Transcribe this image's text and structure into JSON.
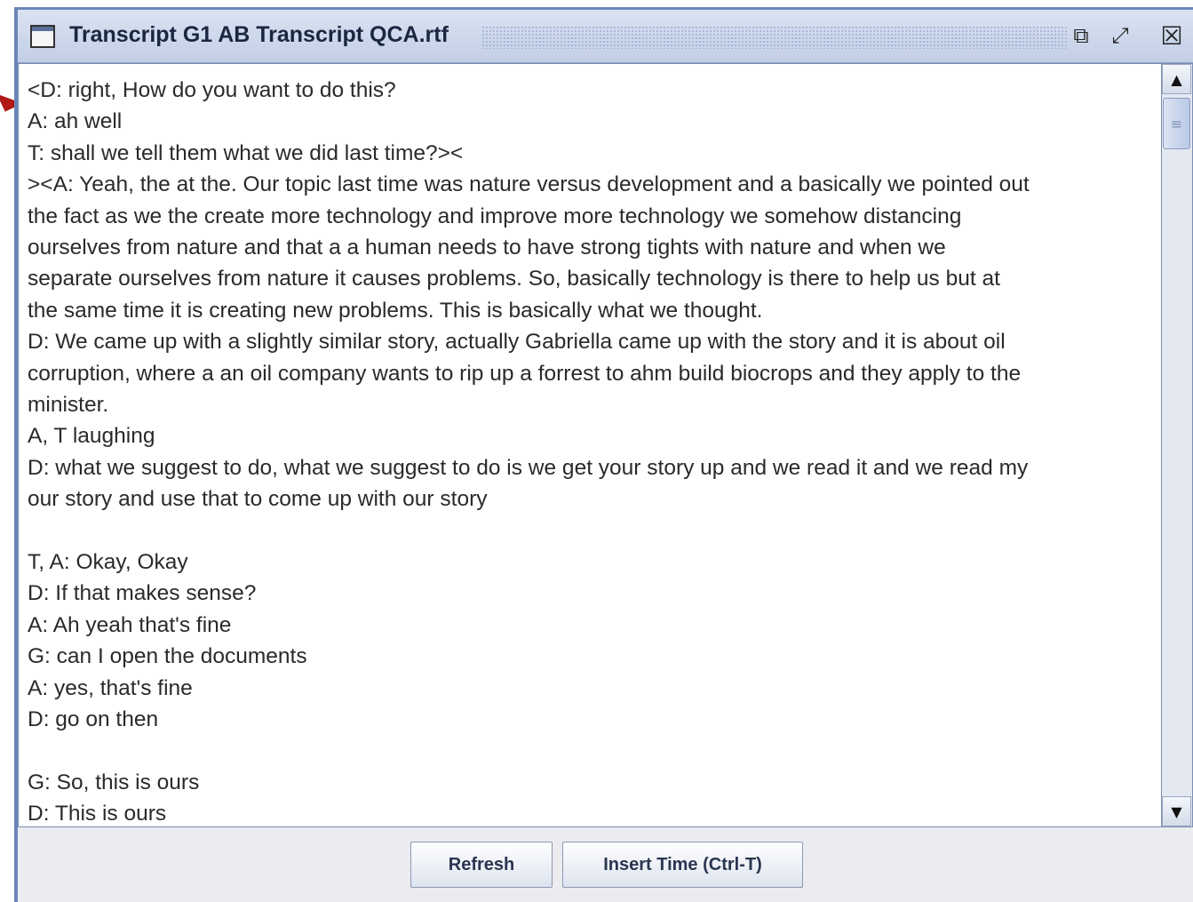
{
  "window": {
    "title": "Transcript G1 AB Transcript QCA.rtf",
    "controls": {
      "minimize_glyph": "⧉",
      "maximize_glyph": "⤢",
      "close_glyph": "☒"
    }
  },
  "transcript": {
    "lines": [
      "<D: right, How do you want to do this?",
      "A: ah well",
      "T: shall we tell them what we did last time?><",
      "><A: Yeah, the at the. Our topic last time was nature versus development and a basically we pointed out",
      "the fact as we the create more technology and improve more technology we somehow distancing",
      "ourselves from nature and that a a human needs to have strong tights with nature and when we",
      "separate ourselves from nature it causes problems. So, basically technology is there to help us but at",
      "the same time it is creating new problems. This is basically what we thought.",
      "D: We came up with a slightly similar story, actually Gabriella came up with the story and it is about oil",
      "corruption, where a an oil company wants to rip up a forrest to ahm build biocrops and they apply to the",
      "minister.",
      "A, T laughing",
      "D: what we suggest to do, what we suggest to do is we get your story up and we read it and we read my",
      "our story and use that to come up with our story",
      "",
      "T, A: Okay, Okay",
      "D: If that makes sense?",
      "A: Ah yeah that's fine",
      "G: can I open the documents",
      "A: yes, that's fine",
      "D: go on then",
      "",
      "G: So, this is ours",
      "D: This is ours"
    ]
  },
  "scrollbar": {
    "up_glyph": "▲",
    "down_glyph": "▼",
    "thumb_glyph": "≡"
  },
  "buttons": {
    "refresh": "Refresh",
    "insert_time": "Insert Time (Ctrl-T)"
  }
}
